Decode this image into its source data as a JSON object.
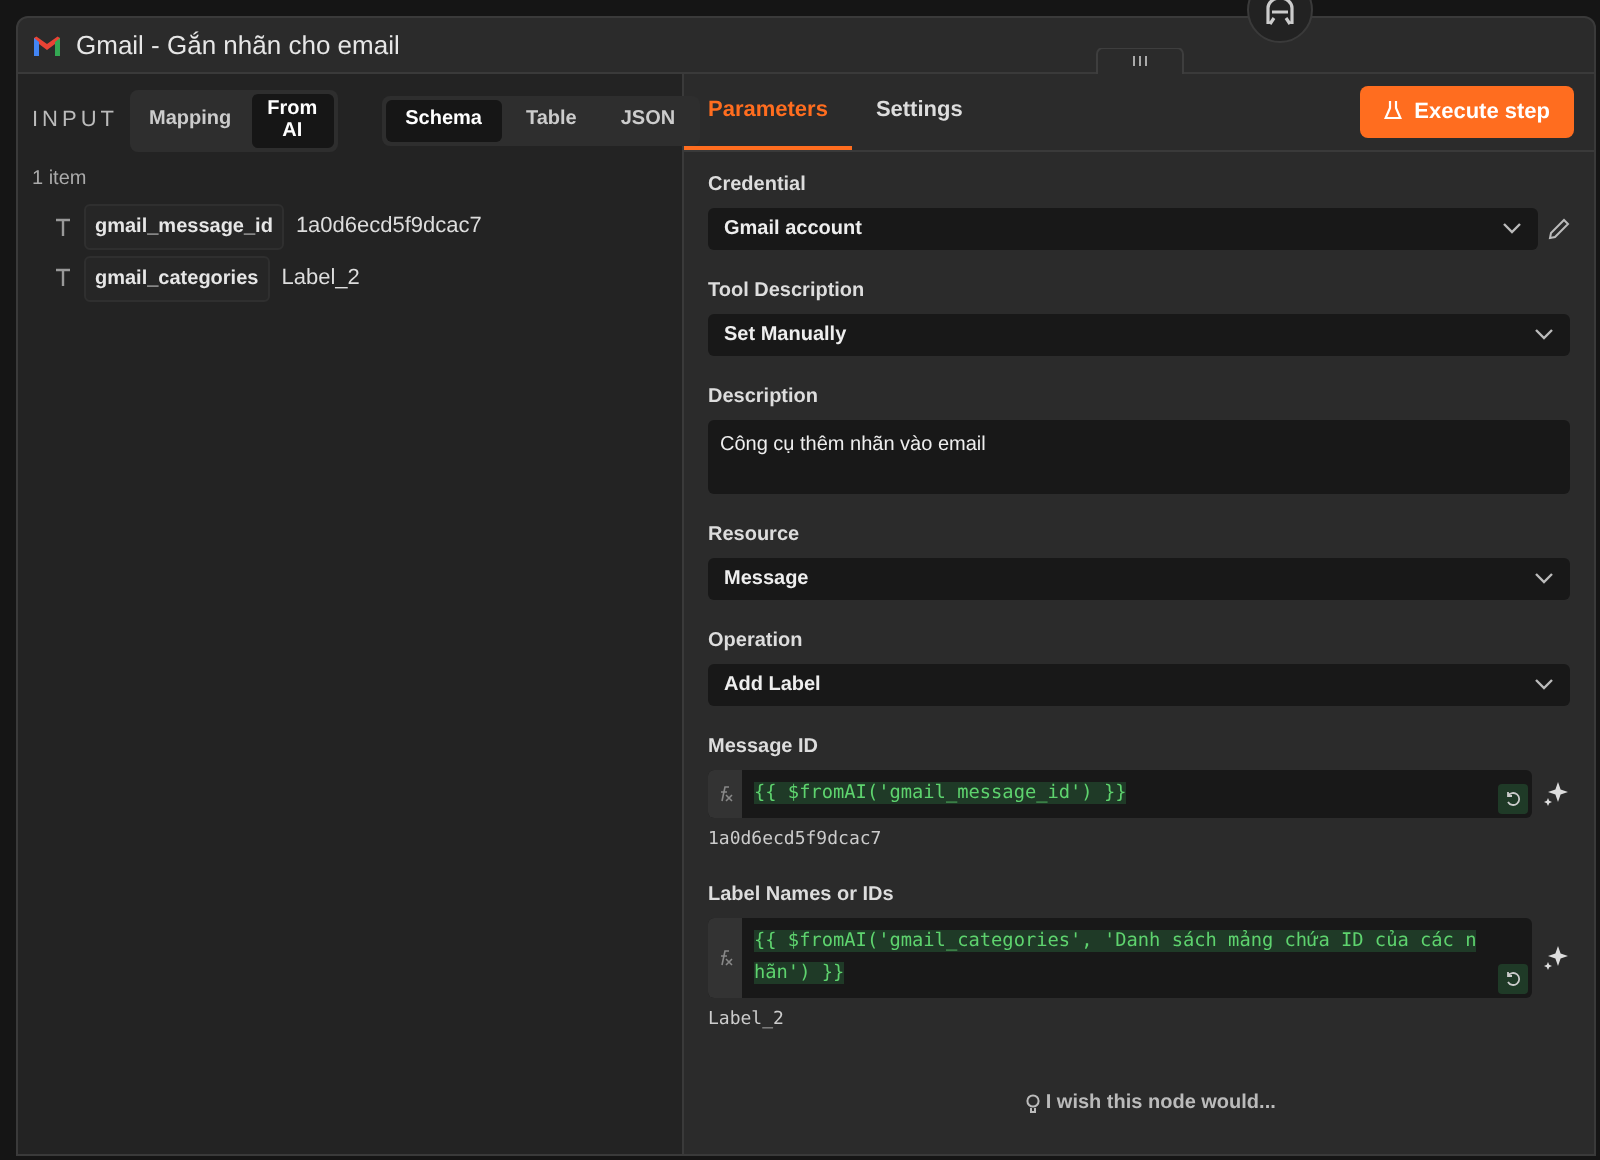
{
  "window": {
    "title": "Gmail - Gắn nhãn cho email"
  },
  "input_panel": {
    "heading": "INPUT",
    "mode_toggle": [
      {
        "label": "Mapping",
        "selected": false
      },
      {
        "label": "From AI",
        "selected": true
      }
    ],
    "view_tabs": [
      {
        "label": "Schema",
        "selected": true
      },
      {
        "label": "Table",
        "selected": false
      },
      {
        "label": "JSON",
        "selected": false
      }
    ],
    "item_count": "1 item",
    "fields": [
      {
        "name": "gmail_message_id",
        "value": "1a0d6ecd5f9dcac7"
      },
      {
        "name": "gmail_categories",
        "value": "Label_2"
      }
    ]
  },
  "parameters_panel": {
    "tabs": [
      {
        "label": "Parameters",
        "selected": true
      },
      {
        "label": "Settings",
        "selected": false
      }
    ],
    "execute_button": "Execute step",
    "params": [
      {
        "kind": "select",
        "label": "Credential",
        "value": "Gmail account",
        "editable": true
      },
      {
        "kind": "select",
        "label": "Tool Description",
        "value": "Set Manually",
        "editable": false
      },
      {
        "kind": "textarea",
        "label": "Description",
        "value": "Công cụ thêm nhãn vào email",
        "editable": false
      },
      {
        "kind": "select",
        "label": "Resource",
        "value": "Message",
        "editable": false
      },
      {
        "kind": "select",
        "label": "Operation",
        "value": "Add Label",
        "editable": false
      },
      {
        "kind": "expression",
        "label": "Message ID",
        "value": "{{ $fromAI('gmail_message_id') }}",
        "result": "1a0d6ecd5f9dcac7",
        "editable": false
      },
      {
        "kind": "expression",
        "label": "Label Names or IDs",
        "value": "{{ $fromAI('gmail_categories', 'Danh sách mảng chứa ID của các nhãn') }}",
        "result": "Label_2",
        "editable": false
      }
    ],
    "feedback_link": "I wish this node would..."
  }
}
